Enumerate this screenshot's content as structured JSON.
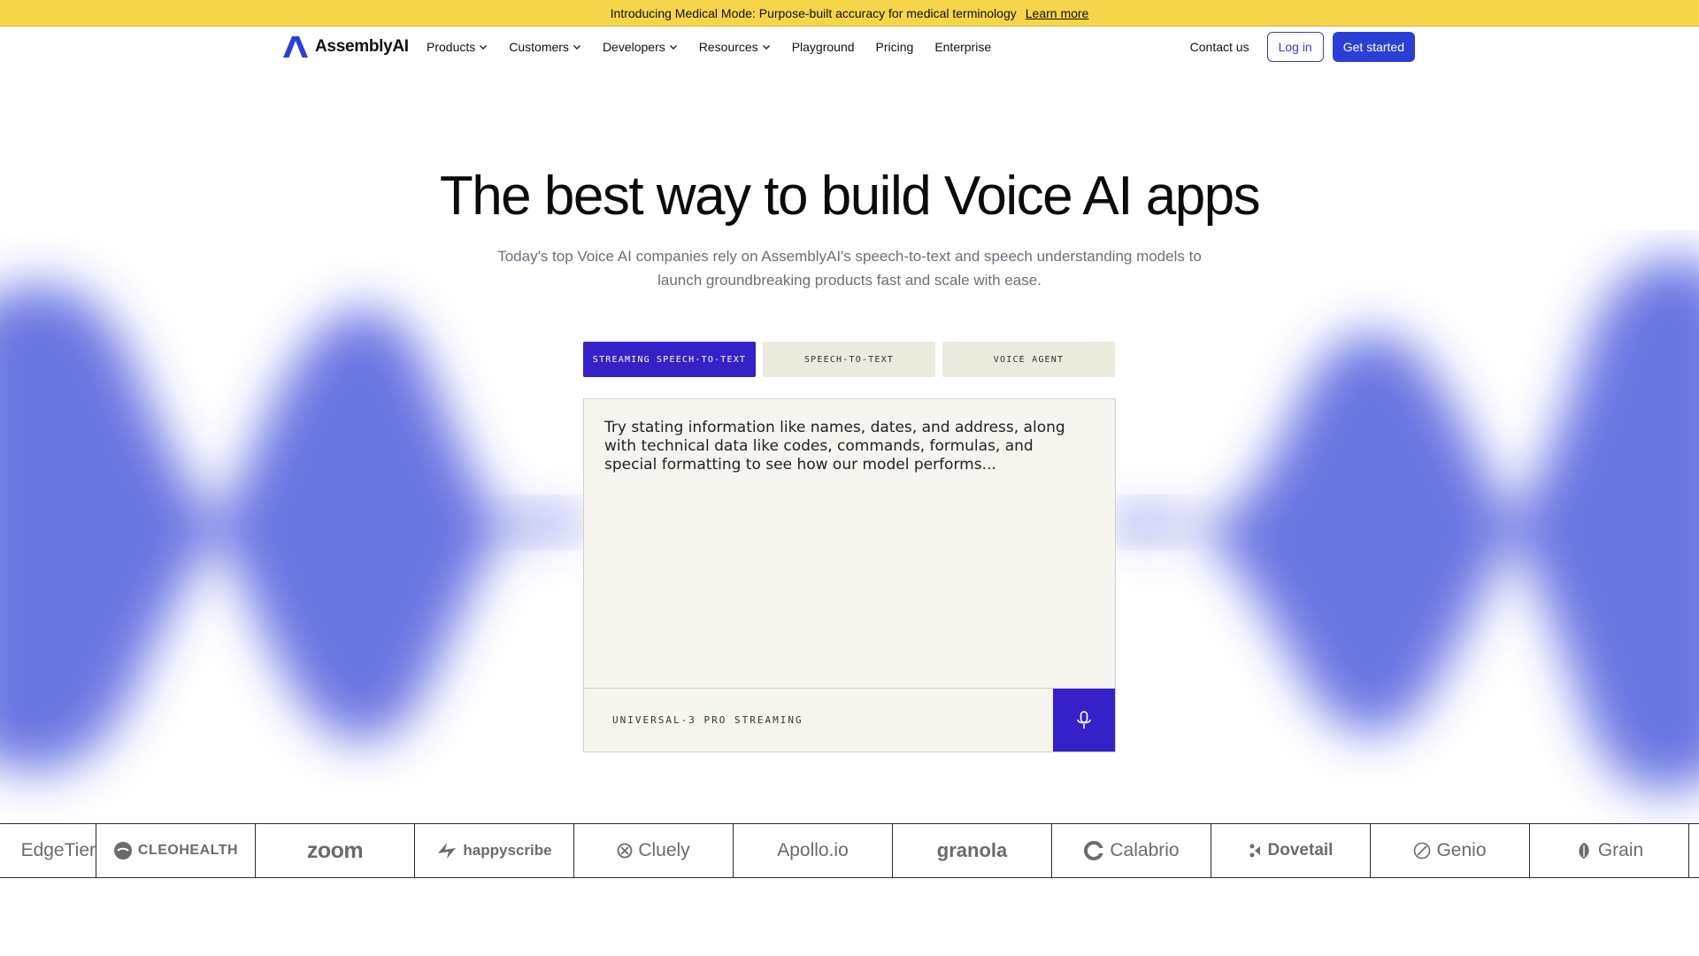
{
  "announcement": {
    "text": "Introducing Medical Mode: Purpose-built accuracy for medical terminology",
    "link": "Learn more"
  },
  "nav": {
    "brand": "AssemblyAI",
    "menu": [
      {
        "label": "Products",
        "has_dropdown": true
      },
      {
        "label": "Customers",
        "has_dropdown": true
      },
      {
        "label": "Developers",
        "has_dropdown": true
      },
      {
        "label": "Resources",
        "has_dropdown": true
      },
      {
        "label": "Playground",
        "has_dropdown": false
      },
      {
        "label": "Pricing",
        "has_dropdown": false
      },
      {
        "label": "Enterprise",
        "has_dropdown": false
      }
    ],
    "contact": "Contact us",
    "login": "Log in",
    "get_started": "Get started"
  },
  "hero": {
    "title": "The best way to build Voice AI apps",
    "subtitle": "Today's top Voice AI companies rely on AssemblyAI's speech-to-text and speech understanding models to launch groundbreaking products fast and scale with ease."
  },
  "tabs": [
    {
      "label": "STREAMING SPEECH-TO-TEXT",
      "active": true
    },
    {
      "label": "SPEECH-TO-TEXT",
      "active": false
    },
    {
      "label": "VOICE AGENT",
      "active": false
    }
  ],
  "demo": {
    "prompt": "Try stating information like names, dates, and address, along with technical data like codes, commands, formulas, and special formatting to see how our model performs...",
    "model": "UNIVERSAL-3 PRO STREAMING",
    "mic_icon": "microphone-icon"
  },
  "logos": [
    "EdgeTier",
    "CLEOHEALTH",
    "zoom",
    "happyscribe",
    "Cluely",
    "Apollo.io",
    "granola",
    "Calabrio",
    "Dovetail",
    "Genio",
    "Grain"
  ],
  "colors": {
    "brand_blue": "#2b3fd6",
    "accent_indigo": "#3621c8",
    "announce_yellow": "#f7d54a",
    "wave_blue": "#5d6be0"
  }
}
